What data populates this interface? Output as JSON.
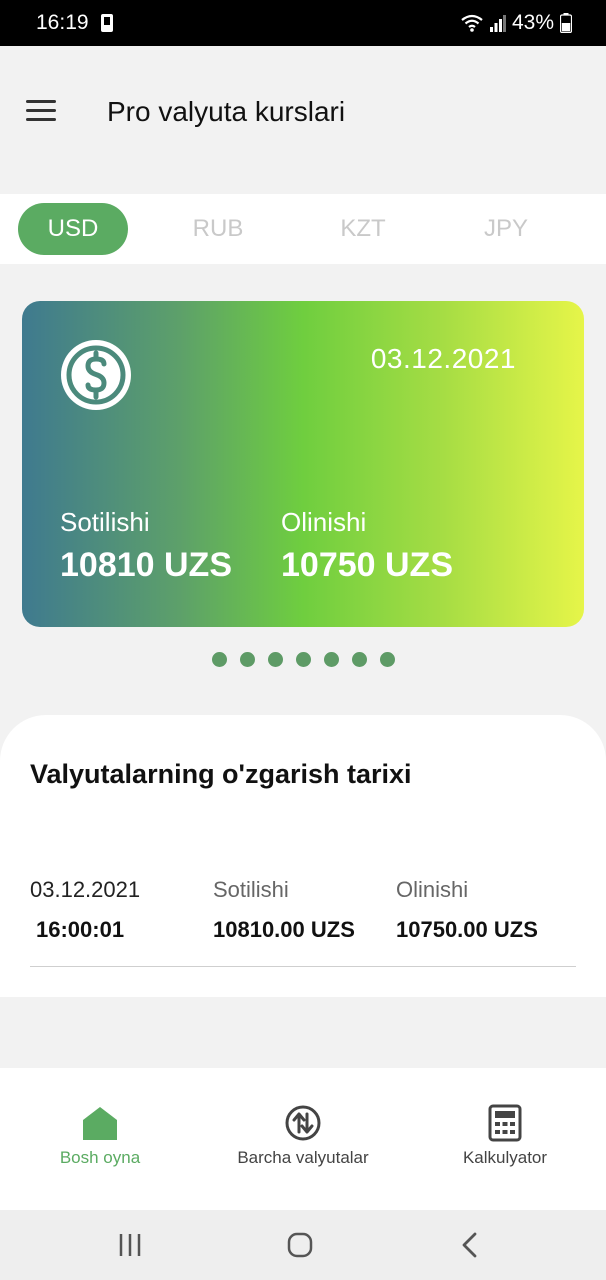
{
  "status_bar": {
    "time": "16:19",
    "battery": "43%"
  },
  "app_bar": {
    "title": "Pro valyuta kurslari"
  },
  "tabs": [
    {
      "label": "USD",
      "active": true
    },
    {
      "label": "RUB",
      "active": false
    },
    {
      "label": "KZT",
      "active": false
    },
    {
      "label": "JPY",
      "active": false
    }
  ],
  "card": {
    "date": "03.12.2021",
    "icon": "dollar-circle-icon",
    "sell_label": "Sotilishi",
    "sell_value": "10810 UZS",
    "buy_label": "Olinishi",
    "buy_value": "10750 UZS",
    "gradient_colors": [
      "#3f7a8f",
      "#6fce3f",
      "#e6f549"
    ]
  },
  "pager": {
    "count": 7,
    "current": 1,
    "color": "#5e9b66"
  },
  "history": {
    "title": "Valyutalarning o'zgarish tarixi",
    "rows": [
      {
        "date": "03.12.2021",
        "time": "16:00:01",
        "sell_label": "Sotilishi",
        "sell_value": "10810.00 UZS",
        "buy_label": "Olinishi",
        "buy_value": "10750.00 UZS"
      }
    ]
  },
  "bottom_nav": [
    {
      "label": "Bosh oyna",
      "icon": "home-icon",
      "active": true
    },
    {
      "label": "Barcha valyutalar",
      "icon": "exchange-arrows-icon",
      "active": false
    },
    {
      "label": "Kalkulyator",
      "icon": "calculator-icon",
      "active": false
    }
  ],
  "theme": {
    "accent": "#5bab62"
  }
}
